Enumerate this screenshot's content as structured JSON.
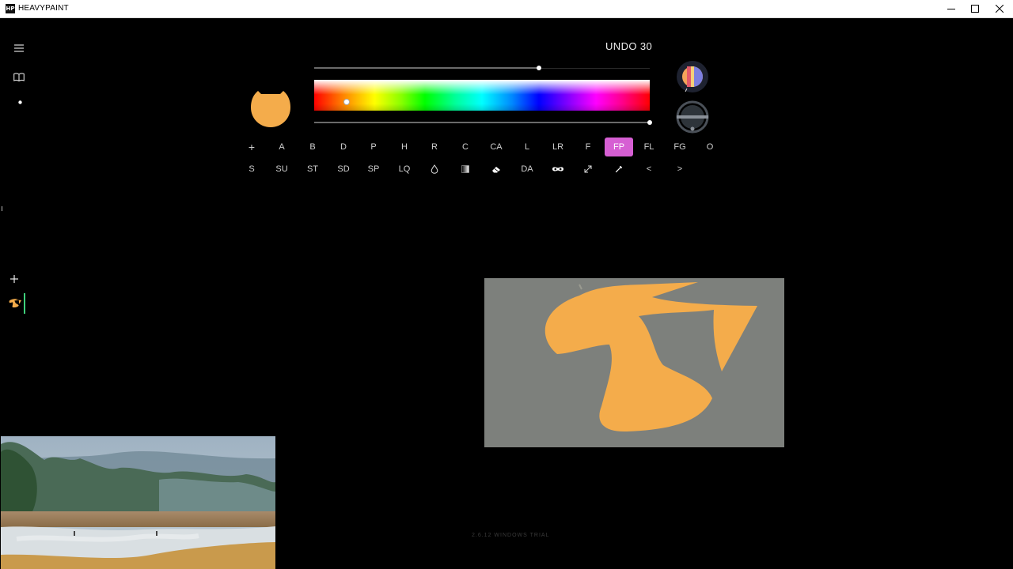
{
  "window": {
    "logo_text": "HP",
    "title": "HEAVYPAINT"
  },
  "header": {
    "undo_label": "UNDO 30"
  },
  "brush": {
    "color": "#F4AC4B",
    "opacity_percent": 67,
    "hue_marker_percent": 9,
    "lightness_percent": 100
  },
  "tools_row1": [
    {
      "label": "+"
    },
    {
      "label": "A"
    },
    {
      "label": "B"
    },
    {
      "label": "D"
    },
    {
      "label": "P"
    },
    {
      "label": "H"
    },
    {
      "label": "R"
    },
    {
      "label": "C"
    },
    {
      "label": "CA"
    },
    {
      "label": "L"
    },
    {
      "label": "LR"
    },
    {
      "label": "F"
    },
    {
      "label": "FP",
      "active": true
    },
    {
      "label": "FL"
    },
    {
      "label": "FG"
    },
    {
      "label": "O"
    }
  ],
  "tools_row2": [
    "S",
    "SU",
    "ST",
    "SD",
    "SP",
    "LQ",
    "",
    "",
    "",
    "DA",
    "",
    "",
    "",
    "<",
    ">"
  ],
  "icons": {
    "window_controls": [
      "minimize-icon",
      "maximize-icon",
      "close-icon"
    ],
    "sidebar": [
      "menu-icon",
      "book-icon",
      "dot-icon",
      "add-layer-icon"
    ],
    "row2": [
      "drop-icon",
      "gradient-icon",
      "eraser-icon",
      "mask-icon",
      "resize-icon",
      "eyedropper-icon"
    ]
  },
  "colors": {
    "accent_active_tool": "#D65FD3",
    "canvas_background": "#7D807C",
    "layer_indicator": "#3FD17C"
  },
  "footer": {
    "version": "2.6.12 WINDOWS TRIAL"
  }
}
